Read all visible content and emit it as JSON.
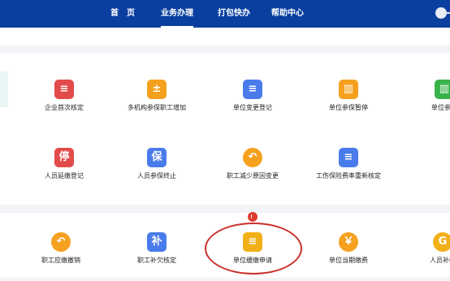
{
  "nav": {
    "items": [
      "首　页",
      "业务办理",
      "打包快办",
      "帮助中心"
    ],
    "active_index": 1
  },
  "row1": [
    {
      "label": "企业首次核定",
      "icon": "enterprise-first-check-icon",
      "color": "#e34b4b"
    },
    {
      "label": "多机构参保职工增加",
      "icon": "staff-add-icon",
      "color": "#f5a11f"
    },
    {
      "label": "单位变更登记",
      "icon": "unit-change-icon",
      "color": "#4a7bea"
    },
    {
      "label": "单位参保暂停",
      "icon": "unit-pause-icon",
      "color": "#f5a11f"
    },
    {
      "label": "单位参保",
      "icon": "unit-insure-icon",
      "color": "#39b34a"
    }
  ],
  "row2": [
    {
      "label": "人员延缴登记",
      "glyph": "停",
      "icon": "personnel-delay-icon",
      "color": "#e34b4b"
    },
    {
      "label": "人员参保终止",
      "glyph": "保",
      "icon": "personnel-terminate-icon",
      "color": "#4a7bea"
    },
    {
      "label": "职工减少原因变更",
      "icon": "reduce-reason-icon",
      "color": "#f5a11f"
    },
    {
      "label": "工伤保险费率重新核定",
      "icon": "injury-rate-icon",
      "color": "#4a7bea"
    }
  ],
  "row3": [
    {
      "label": "职工应缴撤销",
      "icon": "undo-payment-icon",
      "color": "#f5a11f"
    },
    {
      "label": "职工补欠核定",
      "glyph": "补",
      "icon": "clipboard-supplement-icon",
      "color": "#4a7bea"
    },
    {
      "label": "单位缓缴申请",
      "icon": "unit-defer-icon",
      "color": "#f2b018"
    },
    {
      "label": "单位当期缴费",
      "glyph": "￥",
      "icon": "yen-payment-icon",
      "color": "#f5a11f"
    },
    {
      "label": "人员补收",
      "glyph": "G",
      "icon": "personnel-collect-icon",
      "color": "#f2b018"
    }
  ]
}
